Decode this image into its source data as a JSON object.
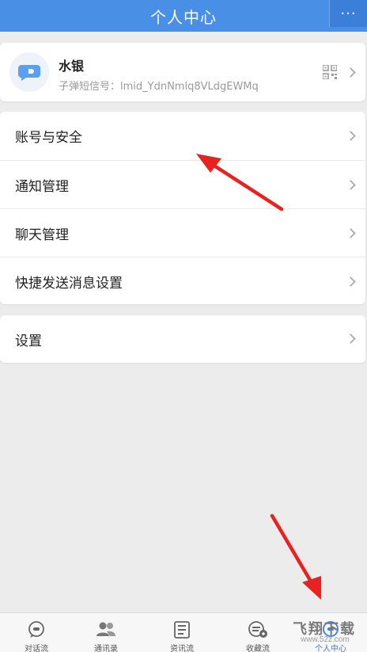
{
  "header": {
    "title": "个人中心",
    "more_label": "···"
  },
  "profile": {
    "name": "水银",
    "id_text": "子弹短信号：lmid_YdnNmlq8VLdgEWMq"
  },
  "menu_group": [
    {
      "label": "账号与安全"
    },
    {
      "label": "通知管理"
    },
    {
      "label": "聊天管理"
    },
    {
      "label": "快捷发送消息设置"
    }
  ],
  "settings": {
    "label": "设置"
  },
  "tabs": [
    {
      "label": "对话流",
      "icon": "chat-bubble-icon"
    },
    {
      "label": "通讯录",
      "icon": "contacts-icon"
    },
    {
      "label": "资讯流",
      "icon": "news-icon"
    },
    {
      "label": "收藏流",
      "icon": "favorites-icon"
    },
    {
      "label": "个人中心",
      "icon": "profile-icon",
      "active": true
    }
  ],
  "watermark": {
    "main": "飞翔下载",
    "url": "www.52z.com"
  },
  "colors": {
    "header": "#4a8fe6",
    "accent": "#3b7fd8",
    "annotation": "#e8231f"
  }
}
